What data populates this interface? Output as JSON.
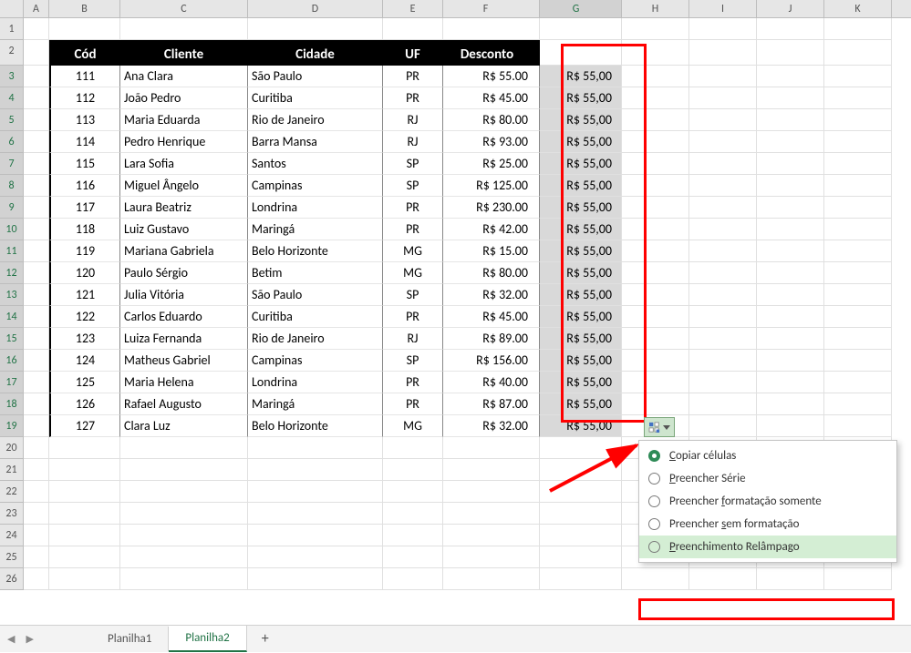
{
  "columns": [
    "A",
    "B",
    "C",
    "D",
    "E",
    "F",
    "G",
    "H",
    "I",
    "J",
    "K"
  ],
  "col_widths": [
    "cA",
    "cB",
    "cC",
    "cD",
    "cE",
    "cF",
    "cG",
    "cH",
    "cI",
    "cJ",
    "cK"
  ],
  "selected_col_idx": 6,
  "headers": {
    "cod": "Cód",
    "cliente": "Cliente",
    "cidade": "Cidade",
    "uf": "UF",
    "desconto": "Desconto"
  },
  "rows": [
    {
      "cod": "111",
      "cliente": "Ana Clara",
      "cidade": "São Paulo",
      "uf": "PR",
      "desconto": "R$ 55.00",
      "g": "R$ 55,00"
    },
    {
      "cod": "112",
      "cliente": "João Pedro",
      "cidade": "Curitiba",
      "uf": "PR",
      "desconto": "R$ 45.00",
      "g": "R$ 55,00"
    },
    {
      "cod": "113",
      "cliente": "Maria Eduarda",
      "cidade": "Rio de Janeiro",
      "uf": "RJ",
      "desconto": "R$ 80.00",
      "g": "R$ 55,00"
    },
    {
      "cod": "114",
      "cliente": "Pedro Henrique",
      "cidade": "Barra Mansa",
      "uf": "RJ",
      "desconto": "R$ 93.00",
      "g": "R$ 55,00"
    },
    {
      "cod": "115",
      "cliente": "Lara Sofia",
      "cidade": "Santos",
      "uf": "SP",
      "desconto": "R$ 25.00",
      "g": "R$ 55,00"
    },
    {
      "cod": "116",
      "cliente": "Miguel Ângelo",
      "cidade": "Campinas",
      "uf": "SP",
      "desconto": "R$ 125.00",
      "g": "R$ 55,00"
    },
    {
      "cod": "117",
      "cliente": "Laura Beatriz",
      "cidade": "Londrina",
      "uf": "PR",
      "desconto": "R$ 230.00",
      "g": "R$ 55,00"
    },
    {
      "cod": "118",
      "cliente": "Luiz Gustavo",
      "cidade": "Maringá",
      "uf": "PR",
      "desconto": "R$ 42.00",
      "g": "R$ 55,00"
    },
    {
      "cod": "119",
      "cliente": "Mariana Gabriela",
      "cidade": "Belo Horizonte",
      "uf": "MG",
      "desconto": "R$ 15.00",
      "g": "R$ 55,00"
    },
    {
      "cod": "120",
      "cliente": "Paulo Sérgio",
      "cidade": "Betim",
      "uf": "MG",
      "desconto": "R$ 80.00",
      "g": "R$ 55,00"
    },
    {
      "cod": "121",
      "cliente": "Julia Vitória",
      "cidade": "São Paulo",
      "uf": "SP",
      "desconto": "R$ 32.00",
      "g": "R$ 55,00"
    },
    {
      "cod": "122",
      "cliente": "Carlos Eduardo",
      "cidade": "Curitiba",
      "uf": "PR",
      "desconto": "R$ 45.00",
      "g": "R$ 55,00"
    },
    {
      "cod": "123",
      "cliente": "Luiza Fernanda",
      "cidade": "Rio de Janeiro",
      "uf": "RJ",
      "desconto": "R$ 89.00",
      "g": "R$ 55,00"
    },
    {
      "cod": "124",
      "cliente": "Matheus Gabriel",
      "cidade": "Campinas",
      "uf": "SP",
      "desconto": "R$ 156.00",
      "g": "R$ 55,00"
    },
    {
      "cod": "125",
      "cliente": "Maria Helena",
      "cidade": "Londrina",
      "uf": "PR",
      "desconto": "R$ 40.00",
      "g": "R$ 55,00"
    },
    {
      "cod": "126",
      "cliente": "Rafael Augusto",
      "cidade": "Maringá",
      "uf": "PR",
      "desconto": "R$ 87.00",
      "g": "R$ 55,00"
    },
    {
      "cod": "127",
      "cliente": "Clara Luz",
      "cidade": "Belo Horizonte",
      "uf": "MG",
      "desconto": "R$ 32.00",
      "g": "R$ 55,00"
    }
  ],
  "empty_rows_after": 7,
  "selected_rows_start": 3,
  "selected_rows_end": 19,
  "autofill_menu": {
    "items": [
      {
        "label": "Copiar células",
        "access": "C",
        "checked": true
      },
      {
        "label": "Preencher Série",
        "access": "P",
        "checked": false
      },
      {
        "label": "Preencher formatação somente",
        "access": "f",
        "checked": false
      },
      {
        "label": "Preencher sem formatação",
        "access": "s",
        "checked": false
      },
      {
        "label": "Preenchimento Relâmpago",
        "access": "P",
        "checked": false
      }
    ],
    "highlight_idx": 4
  },
  "tabs": {
    "sheet1": "Planilha1",
    "sheet2": "Planilha2",
    "add": "+",
    "active": 1
  }
}
